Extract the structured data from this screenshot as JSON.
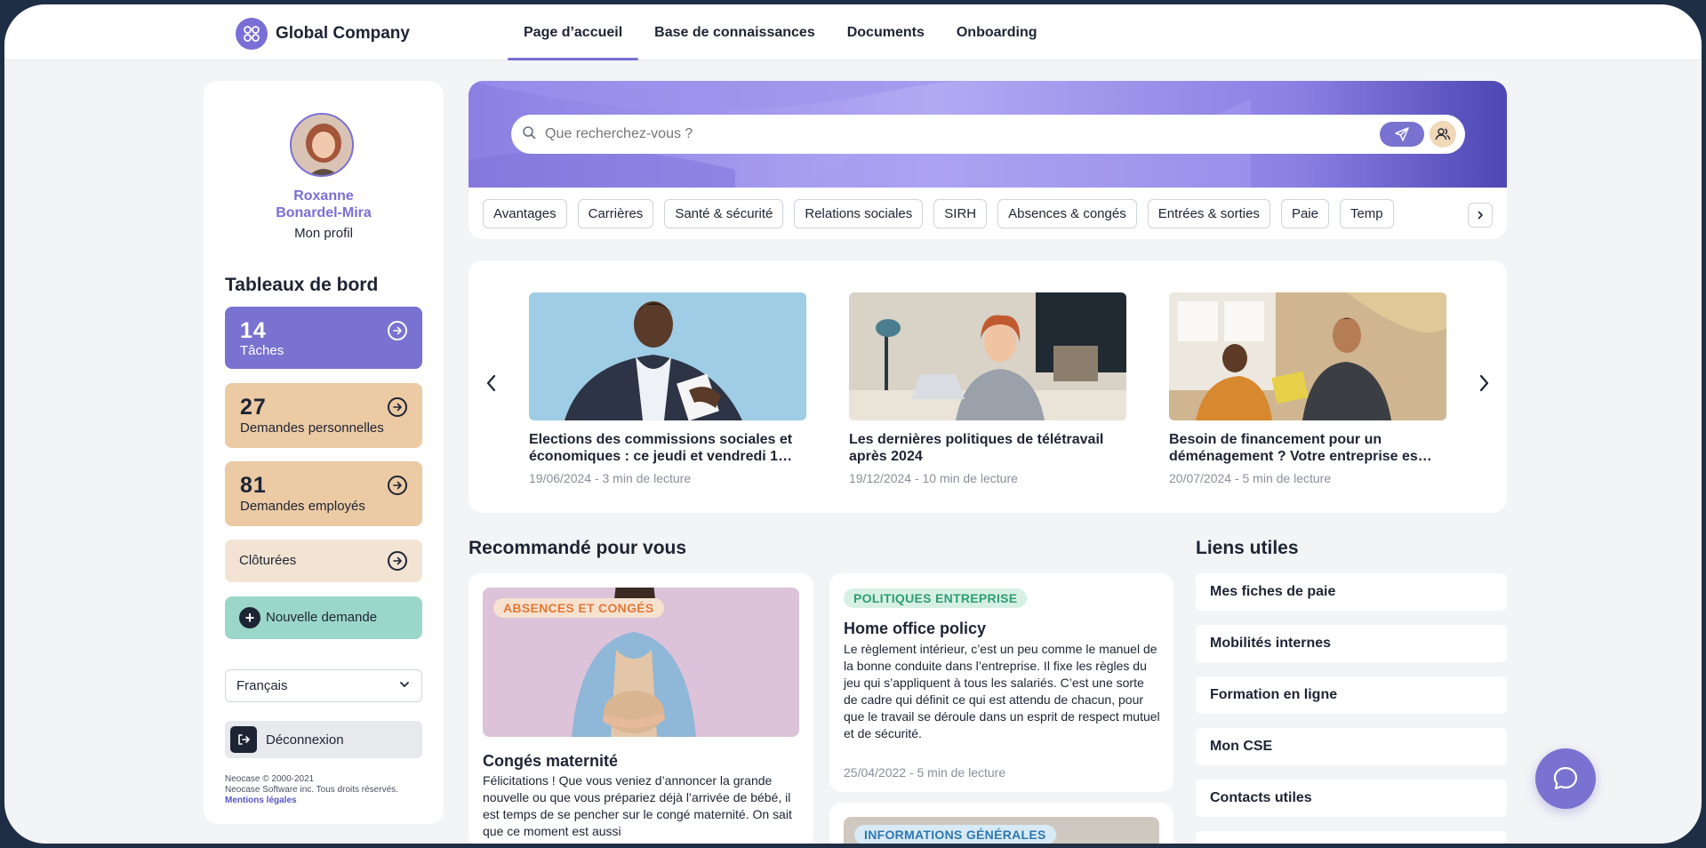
{
  "brand": {
    "name": "Global Company",
    "accent": "#7a72d0"
  },
  "nav": {
    "items": [
      {
        "label": "Page d’accueil",
        "active": true
      },
      {
        "label": "Base de connaissances",
        "active": false
      },
      {
        "label": "Documents",
        "active": false
      },
      {
        "label": "Onboarding",
        "active": false
      }
    ]
  },
  "sidebar": {
    "user_name": "Roxanne Bonardel-Mira",
    "profile_link": "Mon profil",
    "dashboard_title": "Tableaux de bord",
    "cards": [
      {
        "count": "14",
        "label": "Tâches"
      },
      {
        "count": "27",
        "label": "Demandes personnelles"
      },
      {
        "count": "81",
        "label": "Demandes employés"
      }
    ],
    "closed_label": "Clôturées",
    "new_request_label": "Nouvelle demande",
    "language": "Français",
    "logout_label": "Déconnexion",
    "footer": {
      "copyright": "Neocase © 2000-2021",
      "rights": "Neocase Software inc. Tous droits réservés.",
      "legal_link": "Mentions légales"
    }
  },
  "search": {
    "placeholder": "Que recherchez-vous ?",
    "chips": [
      "Avantages",
      "Carrières",
      "Santé & sécurité",
      "Relations sociales",
      "SIRH",
      "Absences & congés",
      "Entrées & sorties",
      "Paie",
      "Temp"
    ]
  },
  "news": [
    {
      "title": "Elections des commissions sociales et économiques : ce jeudi et vendredi 1…",
      "meta": "19/06/2024 - 3 min de lecture"
    },
    {
      "title": "Les dernières politiques de télétravail après 2024",
      "meta": "19/12/2024 - 10 min de lecture"
    },
    {
      "title": "Besoin de financement pour un déménagement ? Votre entreprise es…",
      "meta": "20/07/2024 - 5 min de lecture"
    }
  ],
  "recommended": {
    "title": "Recommandé pour vous",
    "items": [
      {
        "tag": "ABSENCES ET CONGÉS",
        "title": "Congés maternité",
        "text": "Félicitations ! Que vous veniez d’annoncer la grande nouvelle ou que vous prépariez déjà l’arrivée de bébé, il est temps de se pencher sur le congé maternité. On sait que ce moment est aussi"
      },
      {
        "tag": "POLITIQUES ENTREPRISE",
        "title": "Home office policy",
        "text": "Le règlement intérieur, c’est un peu comme le manuel de la bonne conduite dans l’entreprise. Il fixe les règles du jeu qui s’appliquent à tous les salariés. C’est une sorte de cadre qui définit ce qui est attendu de chacun, pour que le travail se déroule dans un esprit de respect mutuel et de sécurité.",
        "meta": "25/04/2022 - 5 min de lecture"
      },
      {
        "tag": "INFORMATIONS GÉNÉRALES"
      }
    ]
  },
  "useful_links": {
    "title": "Liens utiles",
    "items": [
      "Mes fiches de paie",
      "Mobilités internes",
      "Formation en ligne",
      "Mon CSE",
      "Contacts utiles"
    ]
  }
}
